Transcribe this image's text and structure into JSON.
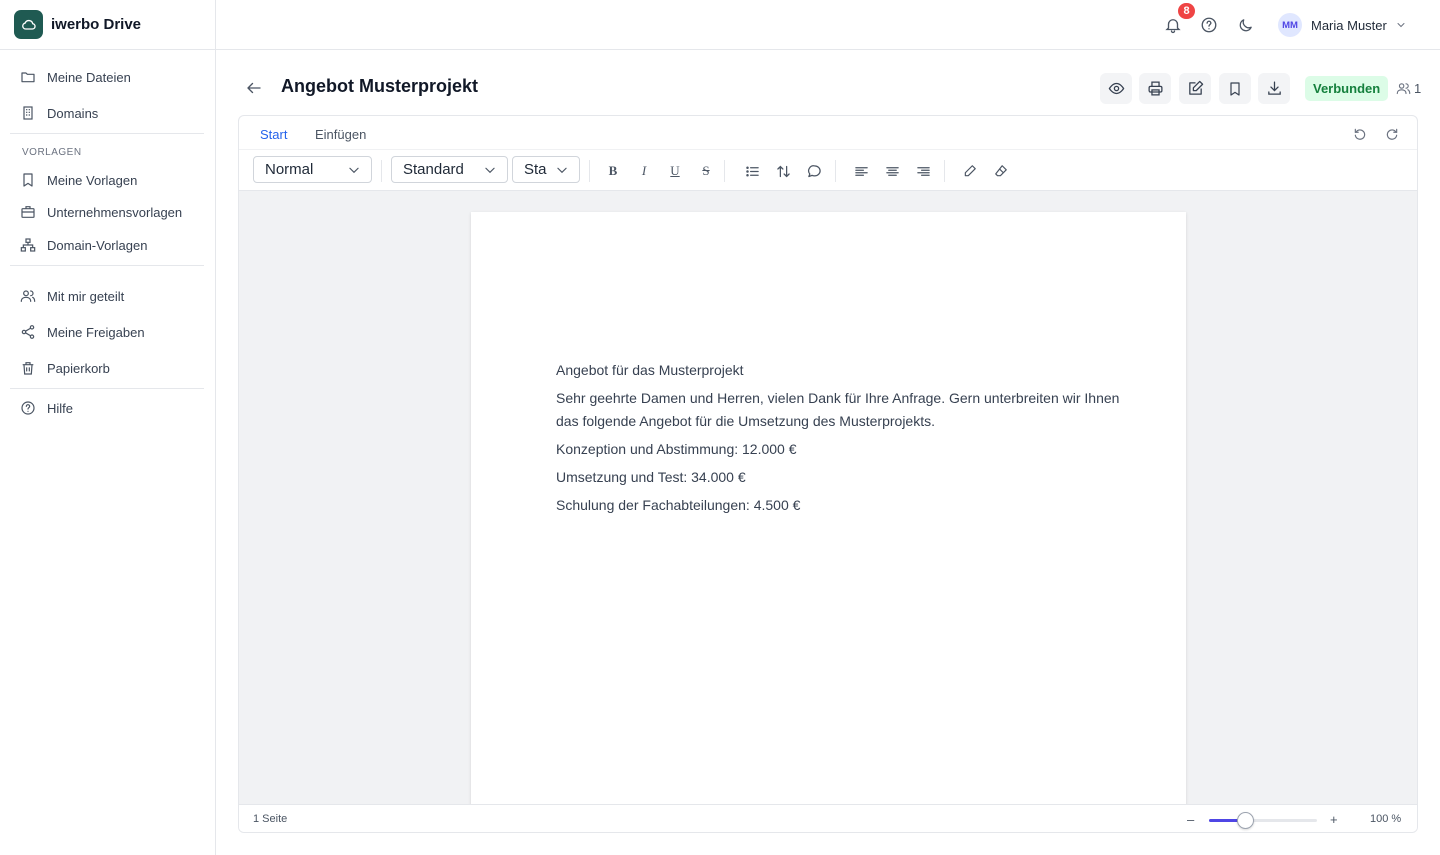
{
  "app": {
    "name": "iwerbo Drive",
    "logo_icon": "cloud-icon",
    "brand_color": "#1f5a52"
  },
  "sidebar": {
    "items_top": [
      {
        "label": "Meine Dateien",
        "icon": "folder-icon"
      },
      {
        "label": "Domains",
        "icon": "building-icon"
      }
    ],
    "section_label": "VORLAGEN",
    "items_templates": [
      {
        "label": "Meine Vorlagen",
        "icon": "bookmark-icon"
      },
      {
        "label": "Unternehmensvorlagen",
        "icon": "briefcase-icon"
      },
      {
        "label": "Domain-Vorlagen",
        "icon": "sitemap-icon"
      }
    ],
    "items_shared": [
      {
        "label": "Mit mir geteilt",
        "icon": "users-icon"
      },
      {
        "label": "Meine Freigaben",
        "icon": "share-icon"
      },
      {
        "label": "Papierkorb",
        "icon": "trash-icon"
      }
    ],
    "items_help": [
      {
        "label": "Hilfe",
        "icon": "help-icon"
      }
    ]
  },
  "topbar": {
    "notification_count": "8",
    "user": {
      "initials": "MM",
      "name": "Maria Muster"
    }
  },
  "document": {
    "title": "Angebot Musterprojekt",
    "status": "Verbunden",
    "status_color": "#15803d",
    "active_users": "1"
  },
  "editor": {
    "tabs": [
      {
        "label": "Start",
        "active": true
      },
      {
        "label": "Einfügen",
        "active": false
      }
    ],
    "toolbar": {
      "paragraph_style": "Normal",
      "font_family": "Standard",
      "font_size": "Sta",
      "bold": "B",
      "italic": "I",
      "underline": "U",
      "strike": "S"
    },
    "content": [
      "Angebot für das Musterprojekt",
      "Sehr geehrte Damen und Herren, vielen Dank für Ihre Anfrage. Gern unterbreiten wir Ihnen das folgende Angebot für die Umsetzung des Musterprojekts.",
      "Konzeption und Abstimmung: 12.000 €",
      "Umsetzung und Test: 34.000 €",
      "Schulung der Fachabteilungen: 4.500 €"
    ],
    "statusbar": {
      "pages": "1 Seite",
      "zoom_minus": "–",
      "zoom_plus": "+",
      "zoom_label": "100 %",
      "zoom_slider_fraction": 0.33
    }
  }
}
